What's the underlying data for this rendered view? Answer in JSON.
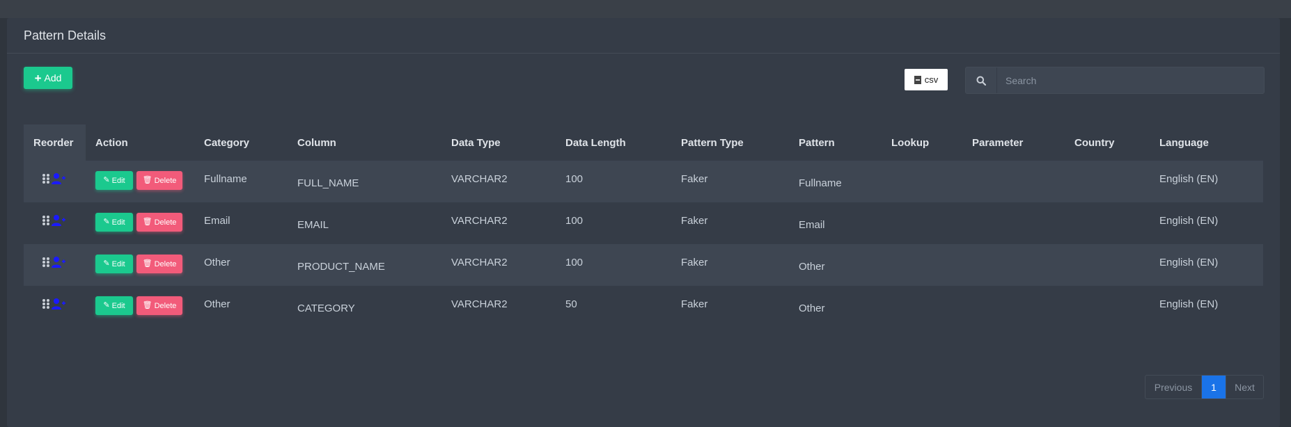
{
  "card": {
    "title": "Pattern Details"
  },
  "toolbar": {
    "add_label": "Add",
    "csv_label": "csv",
    "search_placeholder": "Search",
    "search_value": ""
  },
  "table": {
    "headers": [
      "Reorder",
      "Action",
      "Category",
      "Column",
      "Data Type",
      "Data Length",
      "Pattern Type",
      "Pattern",
      "Lookup",
      "Parameter",
      "Country",
      "Language"
    ],
    "edit_label": "Edit",
    "delete_label": "Delete",
    "rows": [
      {
        "category": "Fullname",
        "column": "FULL_NAME",
        "data_type": "VARCHAR2",
        "data_length": "100",
        "pattern_type": "Faker",
        "pattern": "Fullname",
        "lookup": "",
        "parameter": "",
        "country": "",
        "language": "English (EN)"
      },
      {
        "category": "Email",
        "column": "EMAIL",
        "data_type": "VARCHAR2",
        "data_length": "100",
        "pattern_type": "Faker",
        "pattern": "Email",
        "lookup": "",
        "parameter": "",
        "country": "",
        "language": "English (EN)"
      },
      {
        "category": "Other",
        "column": "PRODUCT_NAME",
        "data_type": "VARCHAR2",
        "data_length": "100",
        "pattern_type": "Faker",
        "pattern": "Other",
        "lookup": "",
        "parameter": "",
        "country": "",
        "language": "English (EN)"
      },
      {
        "category": "Other",
        "column": "CATEGORY",
        "data_type": "VARCHAR2",
        "data_length": "50",
        "pattern_type": "Faker",
        "pattern": "Other",
        "lookup": "",
        "parameter": "",
        "country": "",
        "language": "English (EN)"
      }
    ]
  },
  "pagination": {
    "previous_label": "Previous",
    "current_page": "1",
    "next_label": "Next"
  },
  "icons": {
    "add": "plus-icon",
    "csv": "file-csv-icon",
    "search": "search-icon",
    "drag": "drag-handle-icon",
    "user_add": "user-plus-icon",
    "edit": "edit-icon",
    "delete": "trash-icon"
  },
  "colors": {
    "accent_green": "#1bc98e",
    "danger_pink": "#f25b7a",
    "page_active_blue": "#1a73e8",
    "user_icon_blue": "#1a1aff"
  }
}
